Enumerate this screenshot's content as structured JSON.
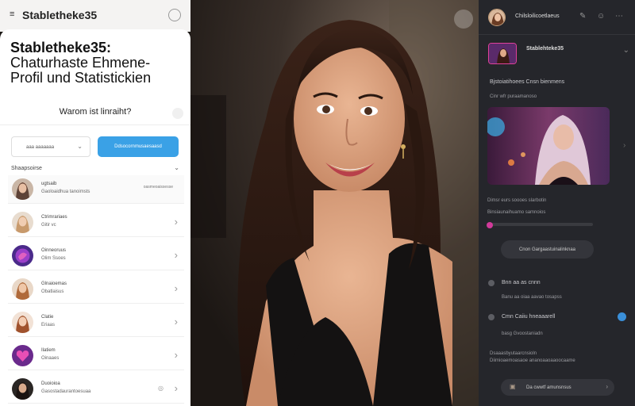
{
  "app": {
    "menu_icon": "≡",
    "title": "Stabletheke35",
    "settings_icon": "⚙"
  },
  "left": {
    "headline_1": "Stabletheke35:",
    "headline_2": "Chaturhaste Ehmene-",
    "headline_3": "Profil und Statistickien",
    "question": "Warom ist linraiht?",
    "select_label": "aaa aaaaaaa",
    "cta_label": "Ddsocornmusaesaasd",
    "section_label": "Shaapsoirse",
    "items": [
      {
        "name": "ugtsaib",
        "sub": "Gaoloaidhua tanoimsts",
        "meta": "oasmeoaissesse"
      },
      {
        "name": "Ctrimrariaes",
        "sub": "Gitir vc",
        "meta": ""
      },
      {
        "name": "Oinneoruus",
        "sub": "Olim Ssoes",
        "meta": ""
      },
      {
        "name": "Glnaioemas",
        "sub": "Obatlaisus",
        "meta": ""
      },
      {
        "name": "Clatie",
        "sub": "Eriaas",
        "meta": ""
      },
      {
        "name": "Ilatiem",
        "sub": "Oinaaes",
        "meta": ""
      },
      {
        "name": "Duoioioa",
        "sub": "Gasostadaurantoesuaa",
        "meta": ""
      }
    ]
  },
  "right": {
    "username": "Chilsloilicoetlaeus",
    "channel_name": "Stablehteke35",
    "heading_1": "Bjstoiatihoees Cnsn bienmens",
    "text_1": "Cinr wfr puraamanoso",
    "text_2": "Dimsr eurs soooes slarbotin",
    "text_3": "Binsiaunaihuamo samnoios",
    "button_label": "Cnon Gargaastuinalinknaa",
    "item_1_title": "Bnn aa as cnnn",
    "item_1_sub": "Banu aa oiaa aavao tosapss",
    "item_2_title": "Cmn Caiiu hneaaarell",
    "item_2_sub": "basg Gvoostaniadn",
    "footnote_1": "Dsaaasbyutaarcnsioln",
    "footnote_2": "Diimioaemoasaoe ananoaaoaaoocaame",
    "footer_label": "Da cwwtf amunsnsus",
    "colors": {
      "accent": "#3aa1e6",
      "pink": "#d13a9a",
      "panel": "#25262b"
    }
  }
}
